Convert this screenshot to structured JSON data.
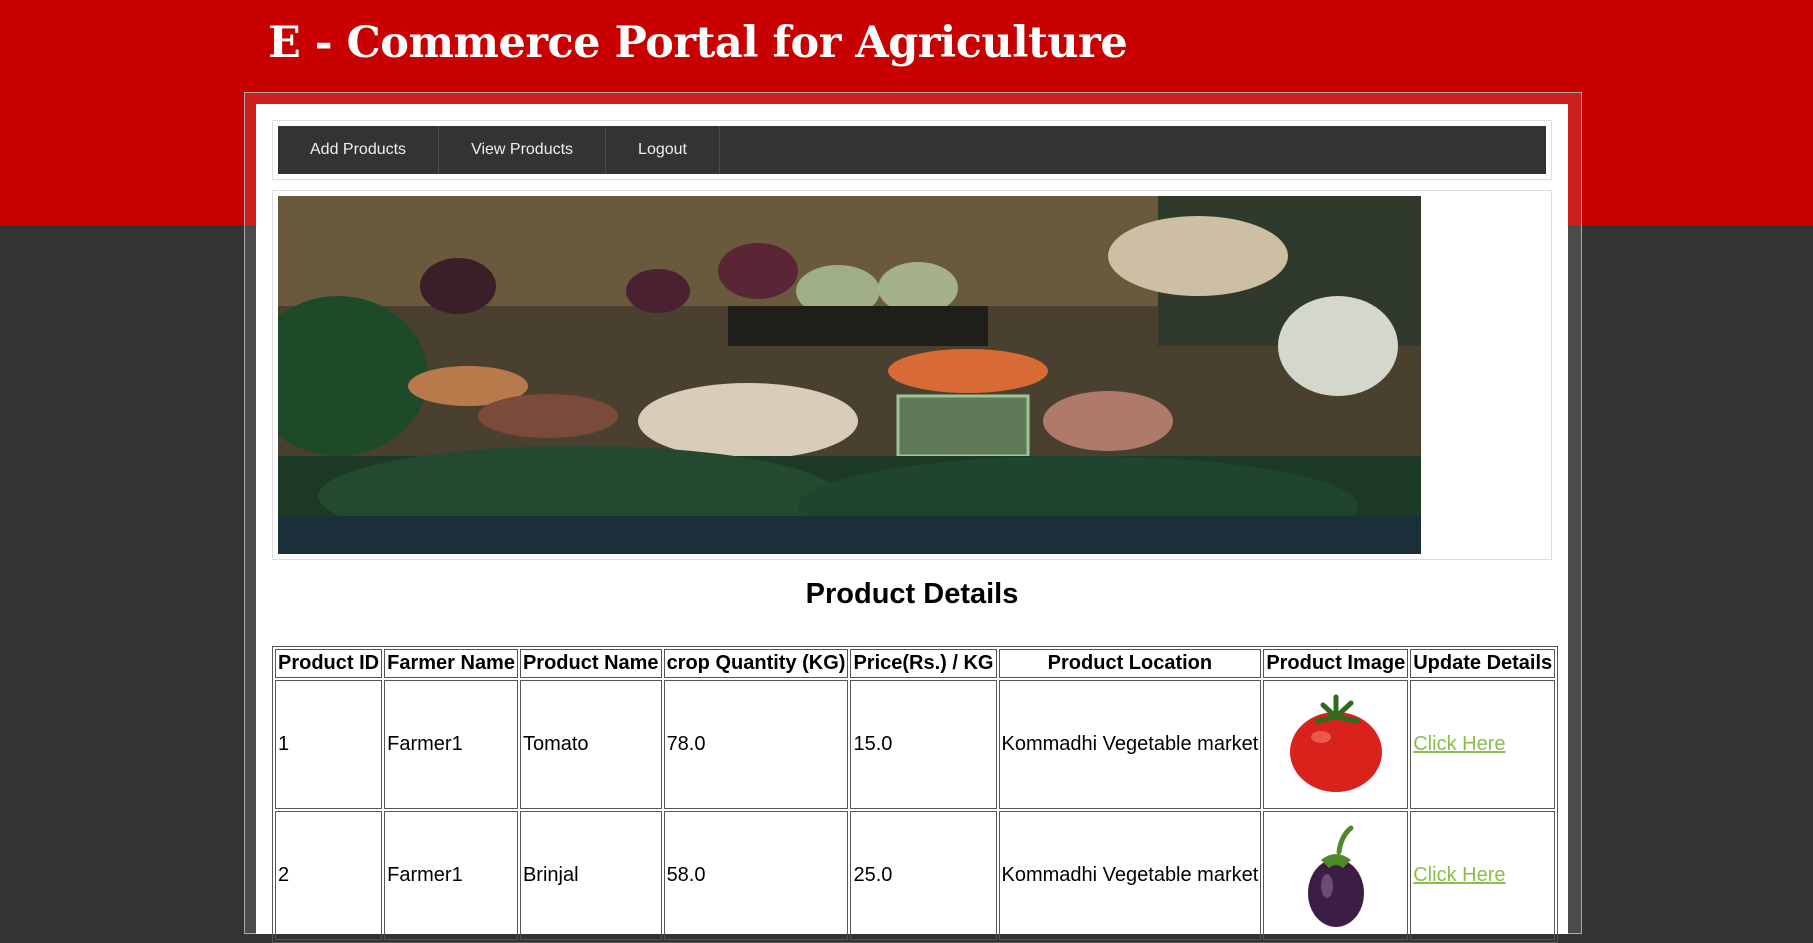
{
  "header": {
    "title": "E - Commerce Portal for Agriculture"
  },
  "nav": {
    "items": [
      {
        "label": "Add Products"
      },
      {
        "label": "View Products"
      },
      {
        "label": "Logout"
      }
    ]
  },
  "main": {
    "section_title": "Product Details",
    "table": {
      "columns": [
        "Product ID",
        "Farmer Name",
        "Product Name",
        "crop Quantity (KG)",
        "Price(Rs.) / KG",
        "Product Location",
        "Product Image",
        "Update Details"
      ],
      "rows": [
        {
          "id": "1",
          "farmer": "Farmer1",
          "product": "Tomato",
          "quantity": "78.0",
          "price": "15.0",
          "location": "Kommadhi Vegetable market",
          "image": "tomato-image",
          "action": "Click Here"
        },
        {
          "id": "2",
          "farmer": "Farmer1",
          "product": "Brinjal",
          "quantity": "58.0",
          "price": "25.0",
          "location": "Kommadhi Vegetable market",
          "image": "brinjal-image",
          "action": "Click Here"
        }
      ]
    }
  },
  "colors": {
    "header_band": "#c80000",
    "background": "#333333",
    "nav_background": "#333333",
    "link": "#8cbd4a"
  }
}
